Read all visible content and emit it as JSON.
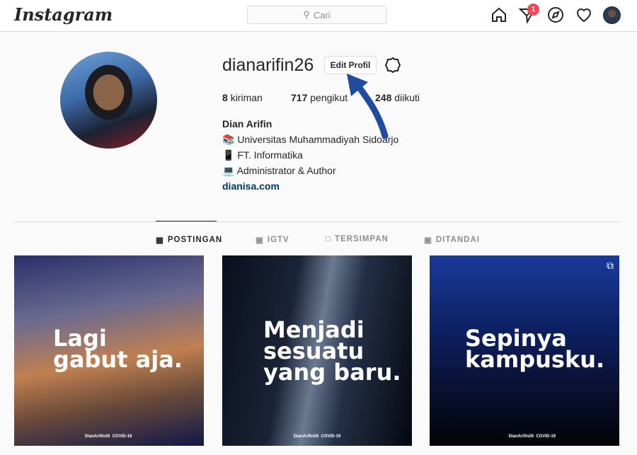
{
  "header": {
    "logo": "Instagram",
    "search_placeholder": "Cari",
    "notification_count": "1"
  },
  "profile": {
    "username": "dianarifin26",
    "edit_button": "Edit Profil",
    "stats": [
      {
        "value": "8",
        "label": "kiriman"
      },
      {
        "value": "717",
        "label": "pengikut"
      },
      {
        "value": "248",
        "label": "diikuti"
      }
    ],
    "name": "Dian Arifin",
    "bio": [
      {
        "emoji": "📚",
        "text": "Universitas Muhammadiyah Sidoarjo"
      },
      {
        "emoji": "📱",
        "text": "FT. Informatika"
      },
      {
        "emoji": "💻",
        "text": "Administrator & Author"
      }
    ],
    "website": "dianisa.com"
  },
  "tabs": [
    {
      "label": "POSTINGAN",
      "icon": "grid-icon",
      "active": true
    },
    {
      "label": "IGTV",
      "icon": "igtv-icon"
    },
    {
      "label": "TERSIMPAN",
      "icon": "bookmark-icon"
    },
    {
      "label": "DITANDAI",
      "icon": "tagged-icon"
    }
  ],
  "posts": [
    {
      "caption": [
        "Lagi",
        "gabut aja."
      ],
      "signature": "DianArifin26",
      "tag": "COVID-19"
    },
    {
      "caption": [
        "Menjadi",
        "sesuatu",
        "yang baru."
      ],
      "signature": "DianArifin26",
      "tag": "COVID-19"
    },
    {
      "caption": [
        "Sepinya",
        "kampusku."
      ],
      "signature": "DianArifin26",
      "tag": "COVID-19",
      "multiple": true
    }
  ],
  "colors": {
    "accent": "#262626",
    "badge": "#ed4956",
    "link": "#00376b",
    "annotation_arrow": "#1f4c9c"
  }
}
